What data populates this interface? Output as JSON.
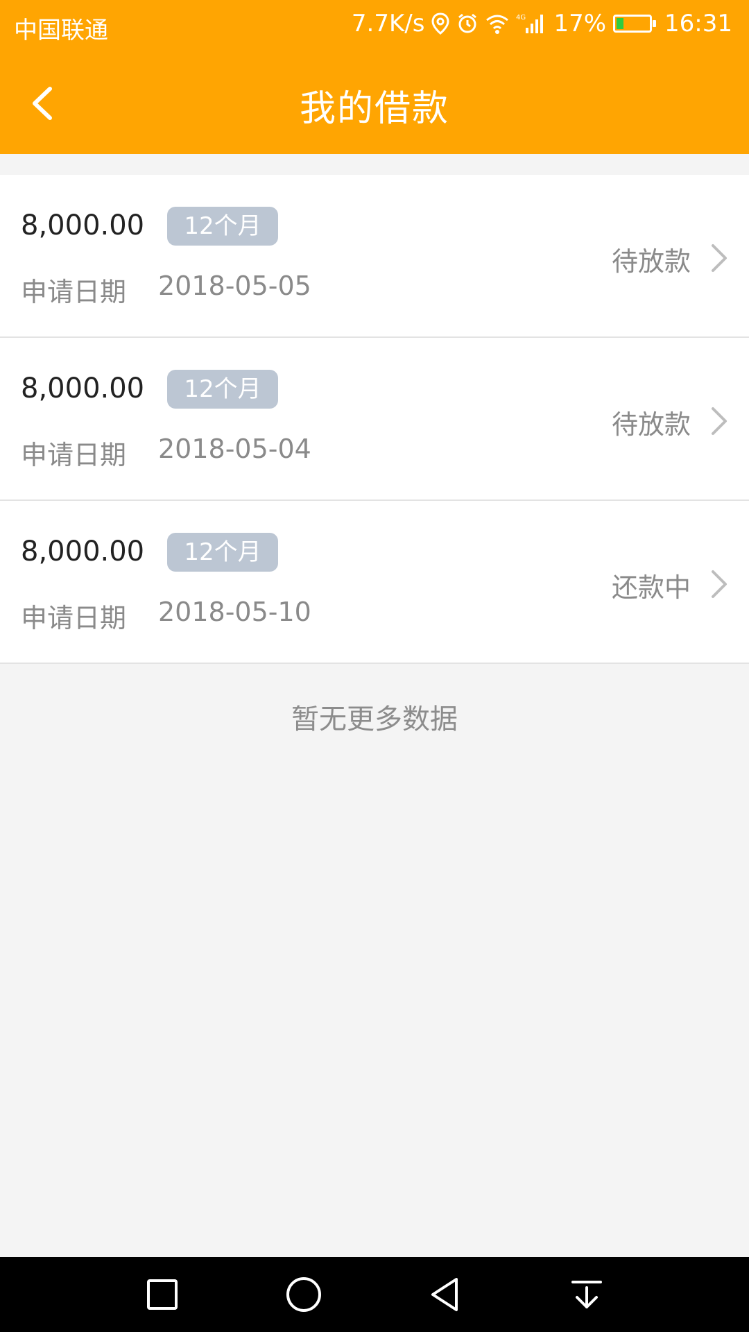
{
  "status_bar": {
    "carrier": "中国联通",
    "net_speed": "7.7K/s",
    "network_type": "4G",
    "battery": "17%",
    "time": "16:31"
  },
  "header": {
    "title": "我的借款"
  },
  "loans": [
    {
      "amount": "8,000.00",
      "term": "12个月",
      "date_label": "申请日期",
      "date": "2018-05-05",
      "status": "待放款"
    },
    {
      "amount": "8,000.00",
      "term": "12个月",
      "date_label": "申请日期",
      "date": "2018-05-04",
      "status": "待放款"
    },
    {
      "amount": "8,000.00",
      "term": "12个月",
      "date_label": "申请日期",
      "date": "2018-05-10",
      "status": "还款中"
    }
  ],
  "footer_text": "暂无更多数据",
  "colors": {
    "brand": "#ffa502",
    "tag_bg": "#bcc6d3",
    "battery_fill": "#2ecc40"
  }
}
